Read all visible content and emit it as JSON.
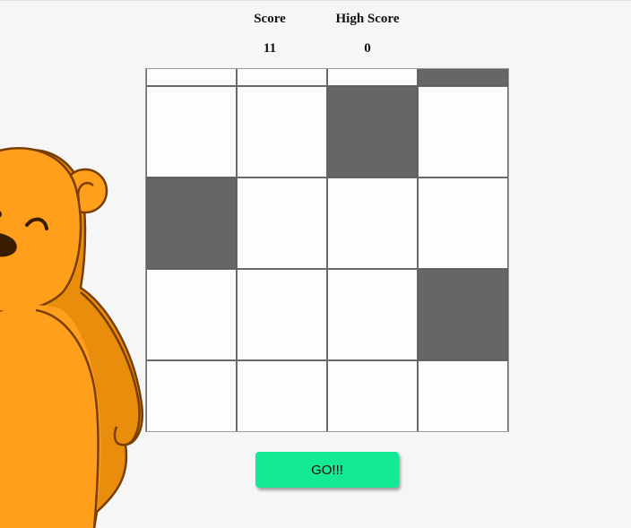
{
  "scoreboard": {
    "score_label": "Score",
    "score_value": "11",
    "high_score_label": "High Score",
    "high_score_value": "0"
  },
  "board": {
    "columns": 4,
    "rows": [
      [
        false,
        false,
        false,
        true
      ],
      [
        false,
        false,
        true,
        false
      ],
      [
        true,
        false,
        false,
        false
      ],
      [
        false,
        false,
        false,
        true
      ],
      [
        false,
        false,
        false,
        false
      ]
    ],
    "tile_color_dark": "#666666",
    "tile_color_light": "#fdfdfd"
  },
  "go_button": {
    "label": "GO!!!",
    "color": "#14ea93"
  },
  "mascot": {
    "icon": "bear-mascot-icon",
    "color": "#ff9f1c",
    "outline_color": "#7a3e00"
  }
}
